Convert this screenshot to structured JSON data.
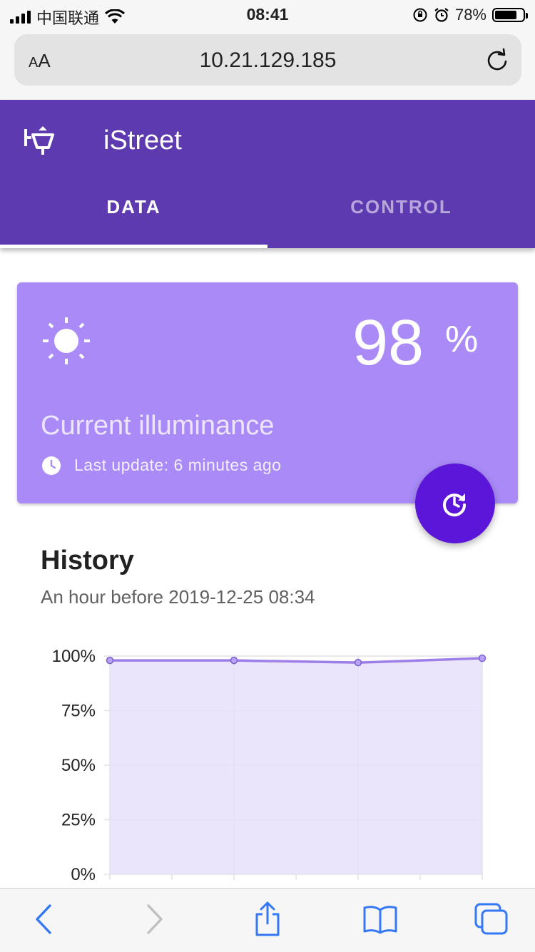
{
  "status_bar": {
    "carrier": "中国联通",
    "time": "08:41",
    "battery": "78%",
    "battery_level": 0.78
  },
  "browser": {
    "text_size_label": "AA",
    "url": "10.21.129.185"
  },
  "app": {
    "title": "iStreet",
    "tabs": [
      {
        "label": "DATA",
        "active": true
      },
      {
        "label": "CONTROL",
        "active": false
      }
    ]
  },
  "illuminance_card": {
    "value": "98",
    "unit": "%",
    "label": "Current illuminance",
    "last_update": "Last update: 6 minutes ago"
  },
  "history": {
    "title": "History",
    "subtitle": "An hour before 2019-12-25 08:34"
  },
  "chart_data": {
    "type": "area",
    "y_ticks": [
      "100%",
      "75%",
      "50%",
      "25%",
      "0%"
    ],
    "ylim": [
      0,
      100
    ],
    "series": [
      {
        "values": [
          98,
          98,
          97,
          99
        ]
      }
    ],
    "grid": true,
    "colors": {
      "line": "#9c7fe8",
      "fill": "#e8e0fb",
      "point": "#9c7fe8"
    }
  },
  "colors": {
    "app_bar": "#5e3ab0",
    "card": "#a98af7",
    "fab": "#5b16d9",
    "ios_blue": "#3478f6"
  }
}
